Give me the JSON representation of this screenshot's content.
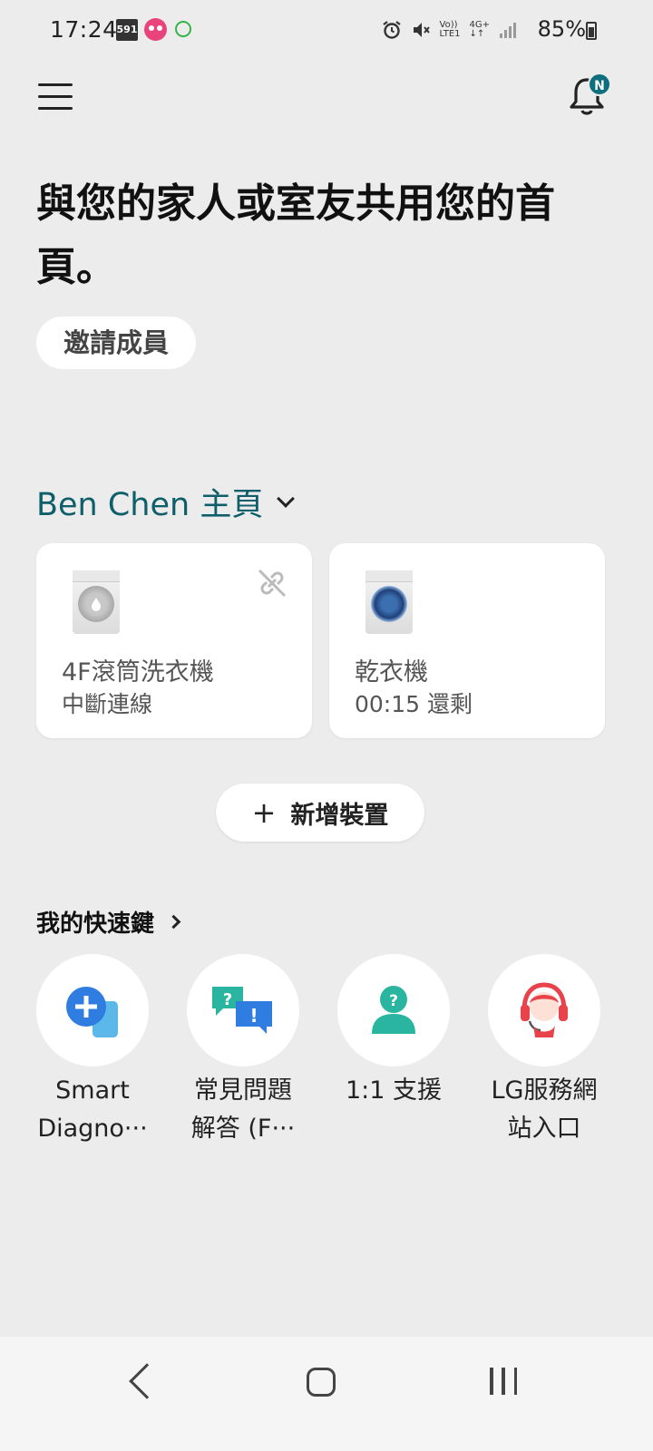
{
  "status_bar": {
    "time": "17:24",
    "app_icon_591": "591",
    "battery": "85%",
    "glyphs": [
      "alarm-icon",
      "mute-icon",
      "volte-icon",
      "4g-icon",
      "signal-icon"
    ]
  },
  "header": {
    "notification_badge": "N"
  },
  "main": {
    "headline": "與您的家人或室友共用您的首頁。",
    "invite_label": "邀請成員",
    "home_title": "Ben Chen 主頁",
    "devices": [
      {
        "name": "4F滾筒洗衣機",
        "status": "中斷連線",
        "icon": "washer-icon",
        "connected": false
      },
      {
        "name": "乾衣機",
        "status": "00:15 還剩",
        "icon": "dryer-icon",
        "connected": true
      }
    ],
    "add_device_label": "新增裝置",
    "shortcuts_title": "我的快速鍵",
    "shortcuts": [
      {
        "label_line1": "Smart",
        "label_line2": "Diagno···",
        "icon": "smart-diagnosis-icon"
      },
      {
        "label_line1": "常見問題",
        "label_line2": "解答 (F···",
        "icon": "faq-icon"
      },
      {
        "label_line1": "1:1 支援",
        "label_line2": "",
        "icon": "support-agent-icon"
      },
      {
        "label_line1": "LG服務網",
        "label_line2": "站入口",
        "icon": "headset-icon"
      }
    ]
  },
  "colors": {
    "background": "#ececec",
    "accent_teal": "#0f5f6b",
    "badge": "#0e6f7e",
    "card": "#ffffff"
  }
}
